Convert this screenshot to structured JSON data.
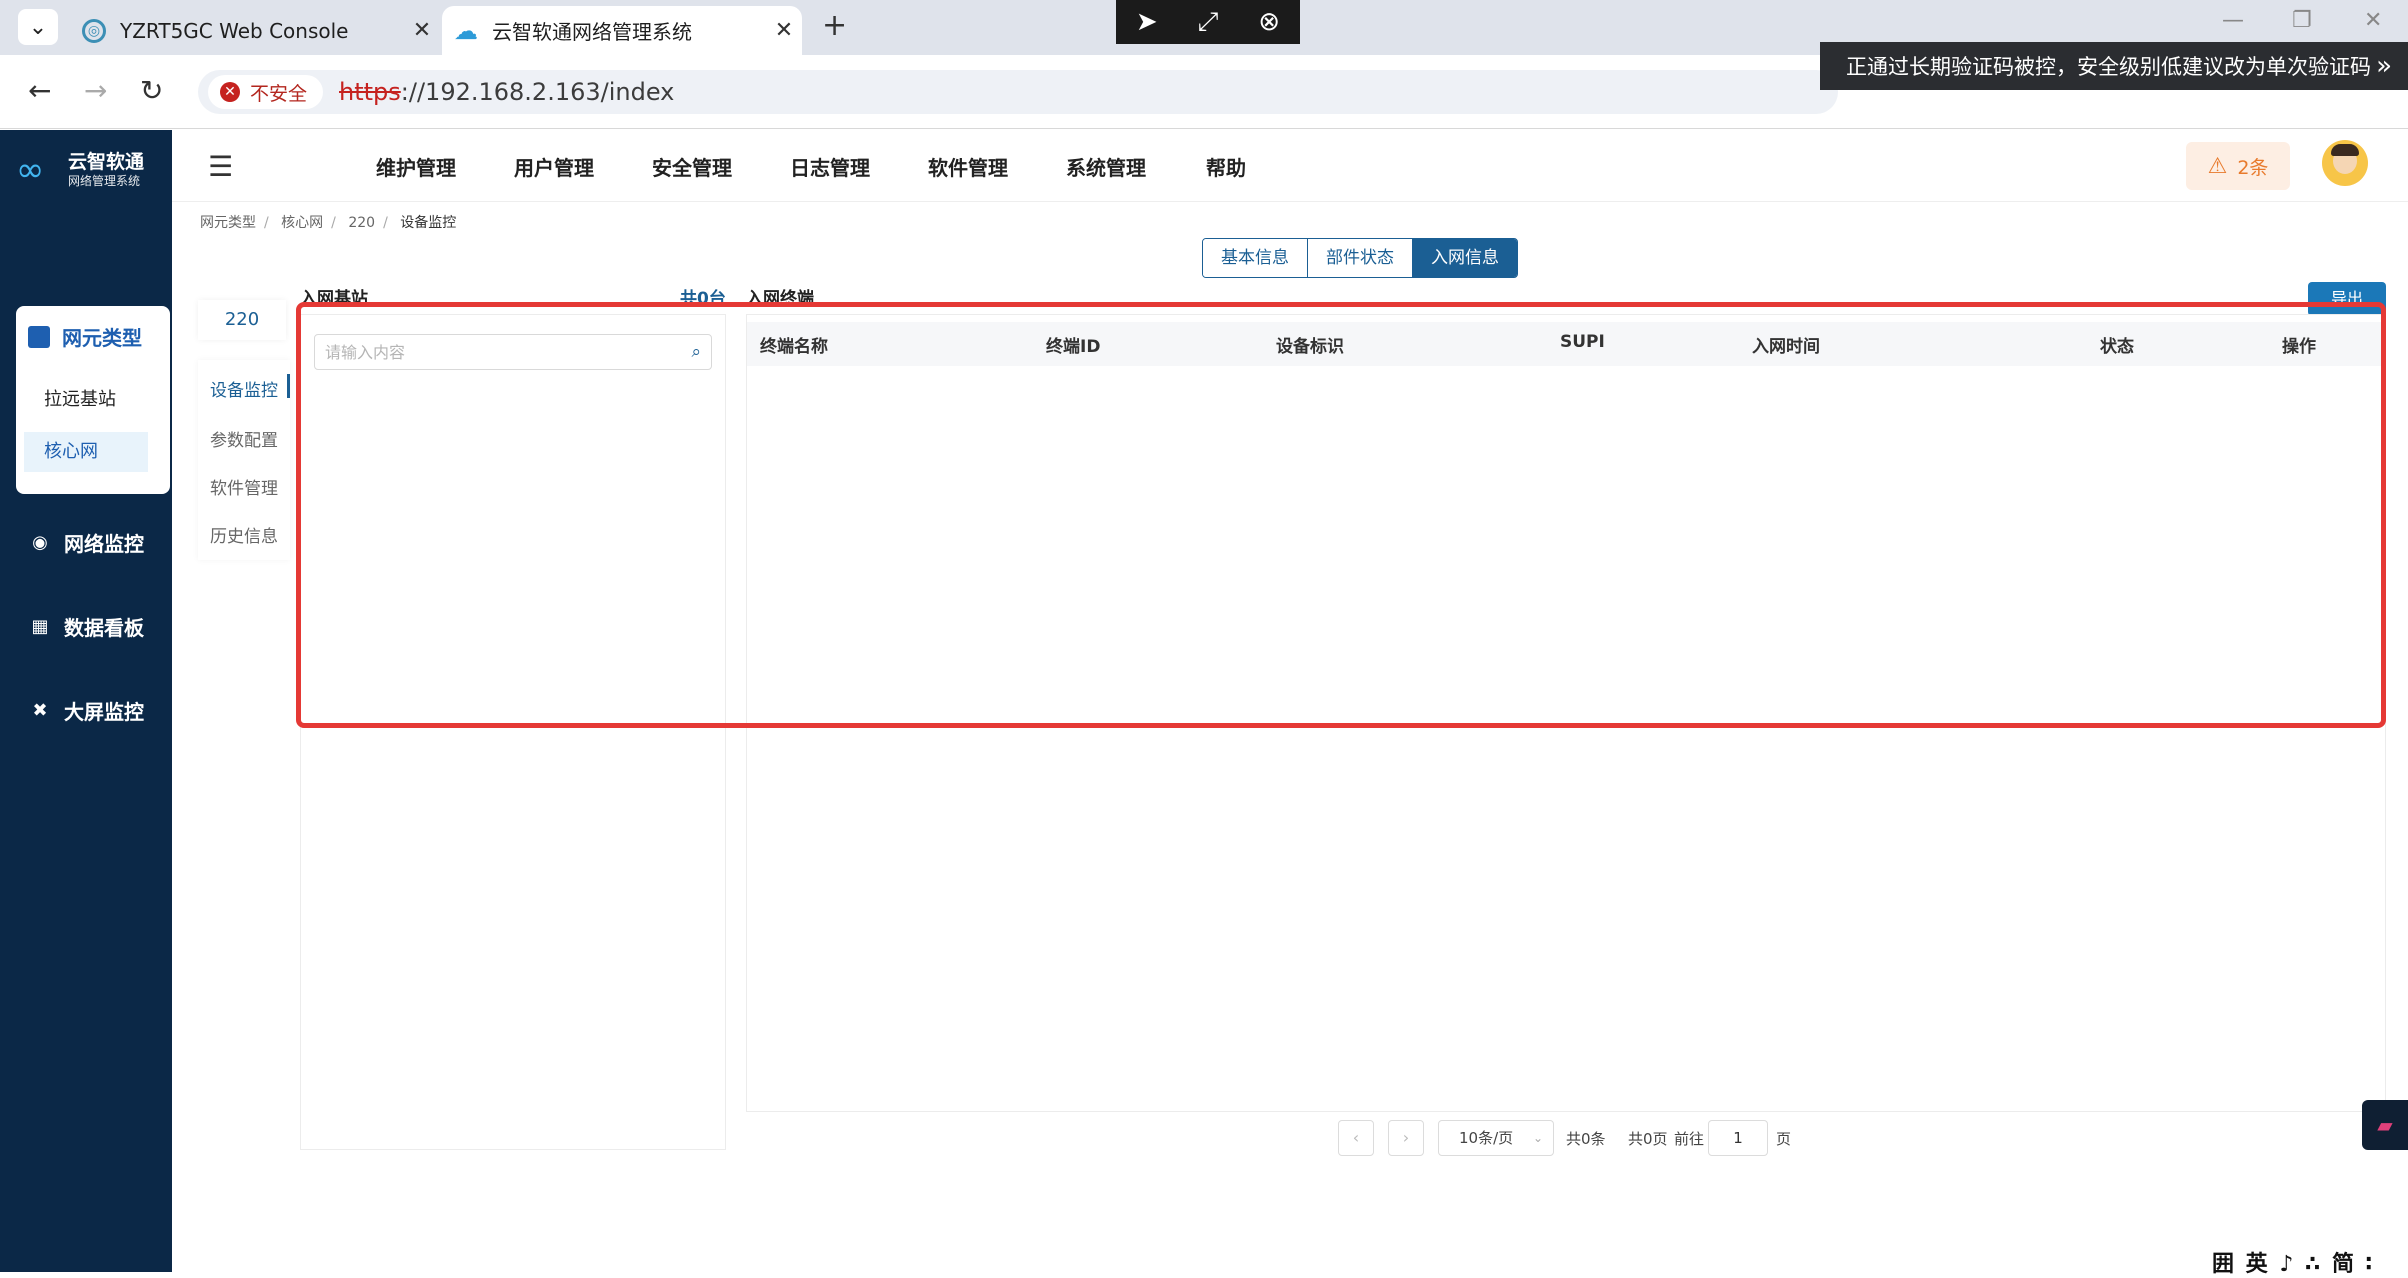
{
  "browser": {
    "tabs": [
      {
        "title": "YZRT5GC Web Console",
        "favicon": "console-icon"
      },
      {
        "title": "云智软通网络管理系统",
        "favicon": "cloud-icon"
      }
    ],
    "address": {
      "security_label": "不安全",
      "url_scheme": "https",
      "url_rest": "://192.168.2.163/index"
    },
    "notice": "正通过长期验证码被控，安全级别低建议改为单次验证码"
  },
  "app": {
    "logo": {
      "name": "云智软通",
      "subtitle": "网络管理系统"
    },
    "sidebar": {
      "group": {
        "label": "网元类型",
        "items": [
          "拉远基站",
          "核心网"
        ]
      },
      "menus": [
        {
          "label": "网络监控",
          "icon": "network-monitor-icon"
        },
        {
          "label": "数据看板",
          "icon": "dashboard-icon"
        },
        {
          "label": "大屏监控",
          "icon": "big-screen-icon"
        }
      ]
    },
    "topnav": [
      "维护管理",
      "用户管理",
      "安全管理",
      "日志管理",
      "软件管理",
      "系统管理",
      "帮助"
    ],
    "alarm": "2条"
  },
  "breadcrumb": [
    "网元类型",
    "核心网",
    "220",
    "设备监控"
  ],
  "tabs": [
    "基本信息",
    "部件状态",
    "入网信息"
  ],
  "device": {
    "name": "220",
    "nav": [
      "设备监控",
      "参数配置",
      "软件管理",
      "历史信息"
    ]
  },
  "left_panel": {
    "title": "入网基站",
    "count": "共0台",
    "search_placeholder": "请输入内容"
  },
  "table": {
    "title": "入网终端",
    "export_label": "导出",
    "columns": [
      "终端名称",
      "终端ID",
      "设备标识",
      "SUPI",
      "入网时间",
      "状态",
      "操作"
    ],
    "rows": []
  },
  "pagination": {
    "page_size": "10条/页",
    "total": "共0条",
    "pages": "共0页",
    "goto": "前往",
    "current": "1",
    "page_unit": "页"
  },
  "ime": "囲 英 ♪ ∴ 简 ∶",
  "colors": {
    "sidebar": "#0b2847",
    "primary": "#1b5f94",
    "highlight": "#e53935",
    "alarm": "#e87a2c"
  }
}
